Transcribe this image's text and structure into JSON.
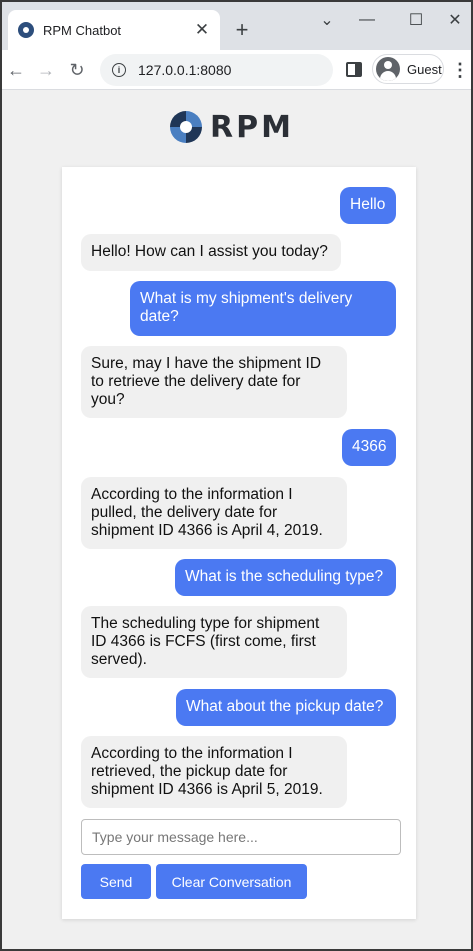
{
  "browser": {
    "tab_title": "RPM Chatbot",
    "tab_close": "✕",
    "new_tab": "+",
    "minimize": "⌄",
    "restore": "—",
    "maximize": "☐",
    "close": "✕",
    "back": "←",
    "forward": "→",
    "reload": "↻",
    "info": "i",
    "url": "127.0.0.1:8080",
    "profile_label": "Guest",
    "menu": "⋮"
  },
  "logo": {
    "text": "RPM"
  },
  "messages": [
    {
      "role": "user",
      "text": "Hello"
    },
    {
      "role": "bot",
      "text": "Hello! How can I assist you today?"
    },
    {
      "role": "user",
      "text": "What is my shipment's delivery date?"
    },
    {
      "role": "bot",
      "text": "Sure, may I have the shipment ID to retrieve the delivery date for you?"
    },
    {
      "role": "user",
      "text": "4366"
    },
    {
      "role": "bot",
      "text": "According to the information I pulled, the delivery date for shipment ID 4366 is April 4, 2019."
    },
    {
      "role": "user",
      "text": "What is the scheduling type?"
    },
    {
      "role": "bot",
      "text": "The scheduling type for shipment ID 4366 is FCFS (first come, first served)."
    },
    {
      "role": "user",
      "text": "What about the pickup date?"
    },
    {
      "role": "bot",
      "text": "According to the information I retrieved, the pickup date for shipment ID 4366 is April 5, 2019."
    }
  ],
  "composer": {
    "placeholder": "Type your message here...",
    "value": "",
    "send_label": "Send",
    "clear_label": "Clear Conversation"
  },
  "colors": {
    "accent": "#4b79f2",
    "bot_bubble": "#f0f0f0"
  }
}
